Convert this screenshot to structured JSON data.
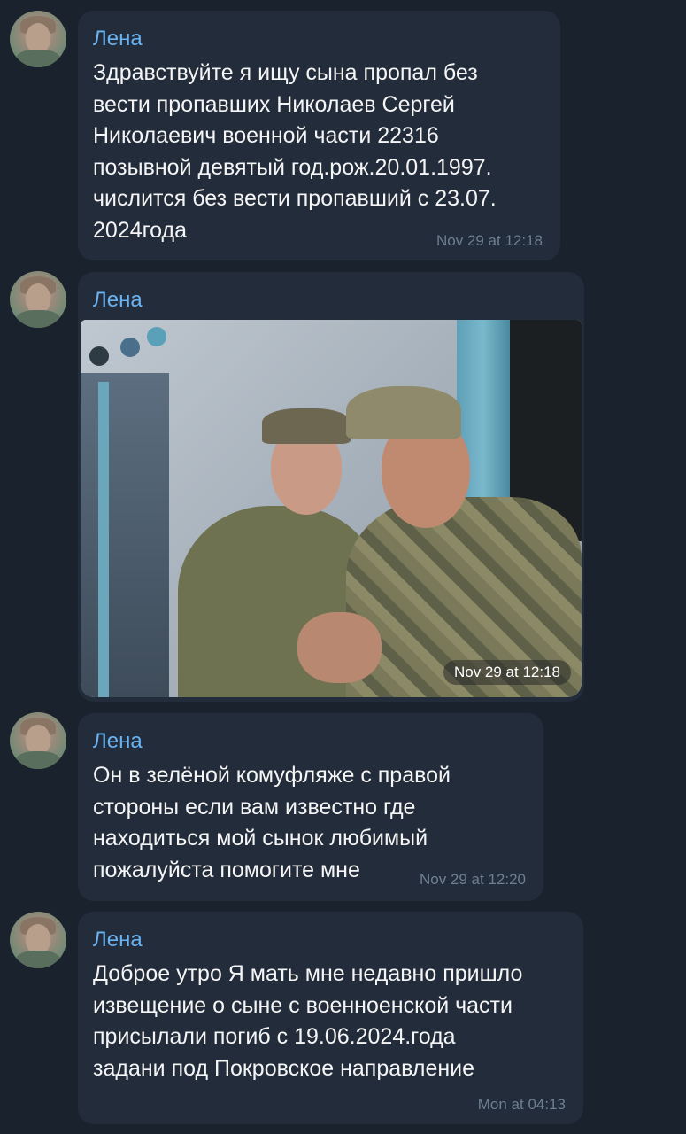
{
  "messages": [
    {
      "sender": "Лена",
      "text": "Здравствуйте я ищу сына пропал без\nвести пропавших Николаев Сергей\nНиколаевич военной части 22316\nпозывной девятый год.рож.20.01.1997.\nчислится без вести пропавший с 23.07.\n2024года",
      "time": "Nov 29 at 12:18"
    },
    {
      "sender": "Лена",
      "photo": "selfie-photo-two-soldiers",
      "time": "Nov 29 at 12:18"
    },
    {
      "sender": "Лена",
      "text": "Он в зелёной комуфляже с правой\nстороны если вам известно где\nнаходиться мой сынок любимый\nпожалуйста помогите мне",
      "time": "Nov 29 at 12:20"
    },
    {
      "sender": "Лена",
      "text": "Доброе утро Я мать мне недавно пришло\nизвещение о сыне с военноенской части\nприсылали погиб с 19.06.2024.года\nзадани под Покровское направление",
      "time": "Mon at 04:13"
    }
  ],
  "colors": {
    "background": "#1a222e",
    "bubble": "#222c3a",
    "sender": "#6ab3f3",
    "text": "#f5f5f5",
    "time": "#6d7f91"
  }
}
